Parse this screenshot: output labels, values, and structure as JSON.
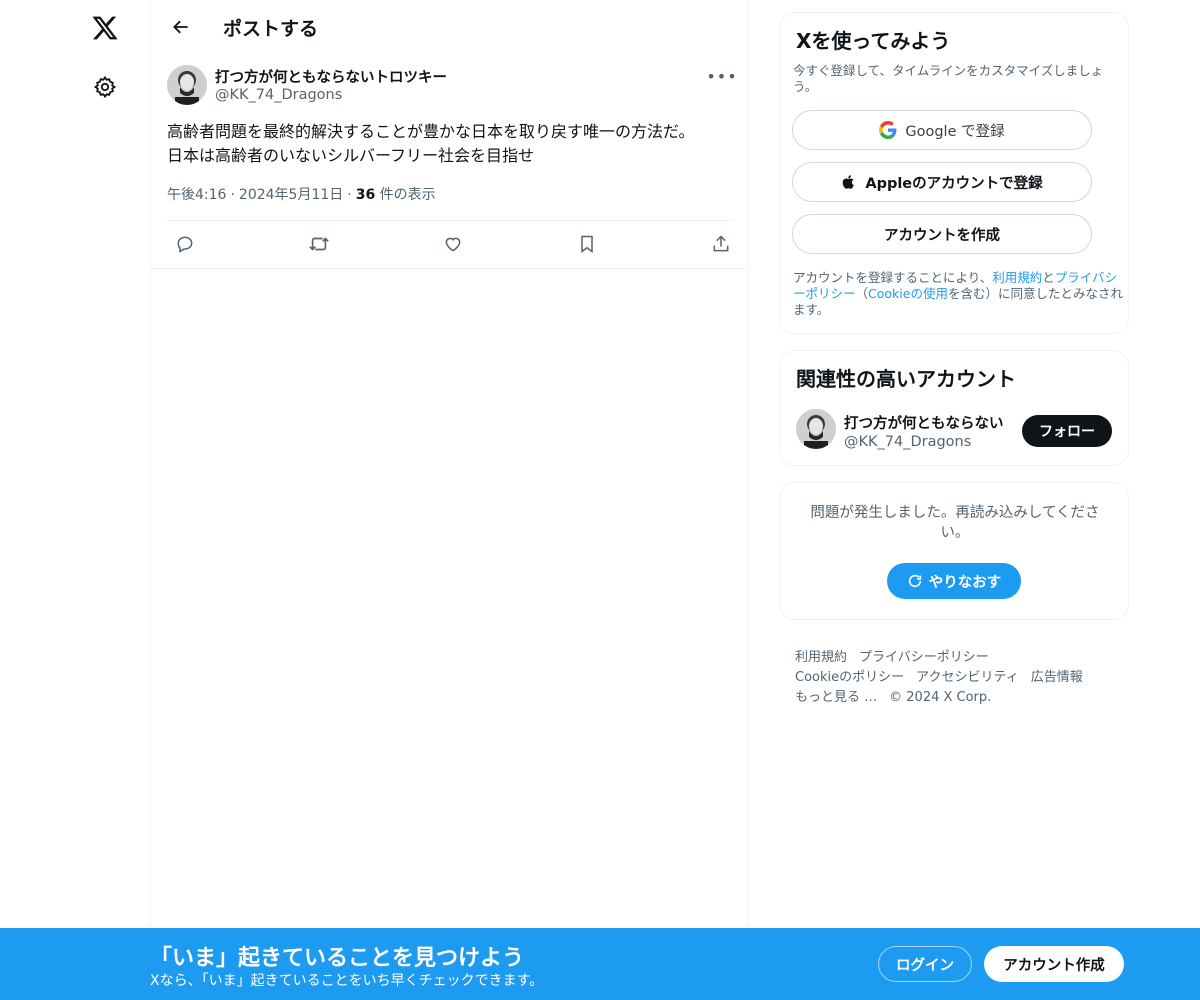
{
  "nav": {
    "logo_icon": "x-logo-icon",
    "settings_icon": "gear-icon"
  },
  "header": {
    "title": "ポストする"
  },
  "post": {
    "author_name": "打つ方が何ともならないトロツキー",
    "author_handle": "@KK_74_Dragons",
    "text_line1": "高齢者問題を最終的解決することが豊かな日本を取り戻す唯一の方法だ。",
    "text_line2": "日本は高齢者のいないシルバーフリー社会を目指せ",
    "time": "午後4:16",
    "date": "2024年5月11日",
    "views_count": "36",
    "views_label": "件の表示"
  },
  "signup": {
    "title": "Xを使ってみよう",
    "subtitle": "今すぐ登録して、タイムラインをカスタマイズしましょう。",
    "google_label": "Google で登録",
    "apple_label": "Appleのアカウントで登録",
    "create_label": "アカウントを作成",
    "legal_pre": "アカウントを登録することにより、",
    "legal_terms": "利用規約",
    "legal_and": "と",
    "legal_privacy": "プライバシーポリシー",
    "legal_paren_open": "（",
    "legal_cookie": "Cookieの使用",
    "legal_post": "を含む）に同意したとみなされます。"
  },
  "related": {
    "title": "関連性の高いアカウント",
    "name": "打つ方が何ともならない",
    "handle": "@KK_74_Dragons",
    "follow_label": "フォロー"
  },
  "error": {
    "message": "問題が発生しました。再読み込みしてください。",
    "retry_label": "やりなおす"
  },
  "footer": {
    "terms": "利用規約",
    "privacy": "プライバシーポリシー",
    "cookie": "Cookieのポリシー",
    "accessibility": "アクセシビリティ",
    "ads": "広告情報",
    "more": "もっと見る …",
    "copyright": "© 2024 X Corp."
  },
  "banner": {
    "title": "「いま」起きていることを見つけよう",
    "subtitle": "Xなら、「いま」起きていることをいち早くチェックできます。",
    "login_label": "ログイン",
    "signup_label": "アカウント作成"
  },
  "colors": {
    "accent": "#1d9bf0",
    "text": "#0f1419",
    "muted": "#536471",
    "border": "#eff3f4"
  }
}
